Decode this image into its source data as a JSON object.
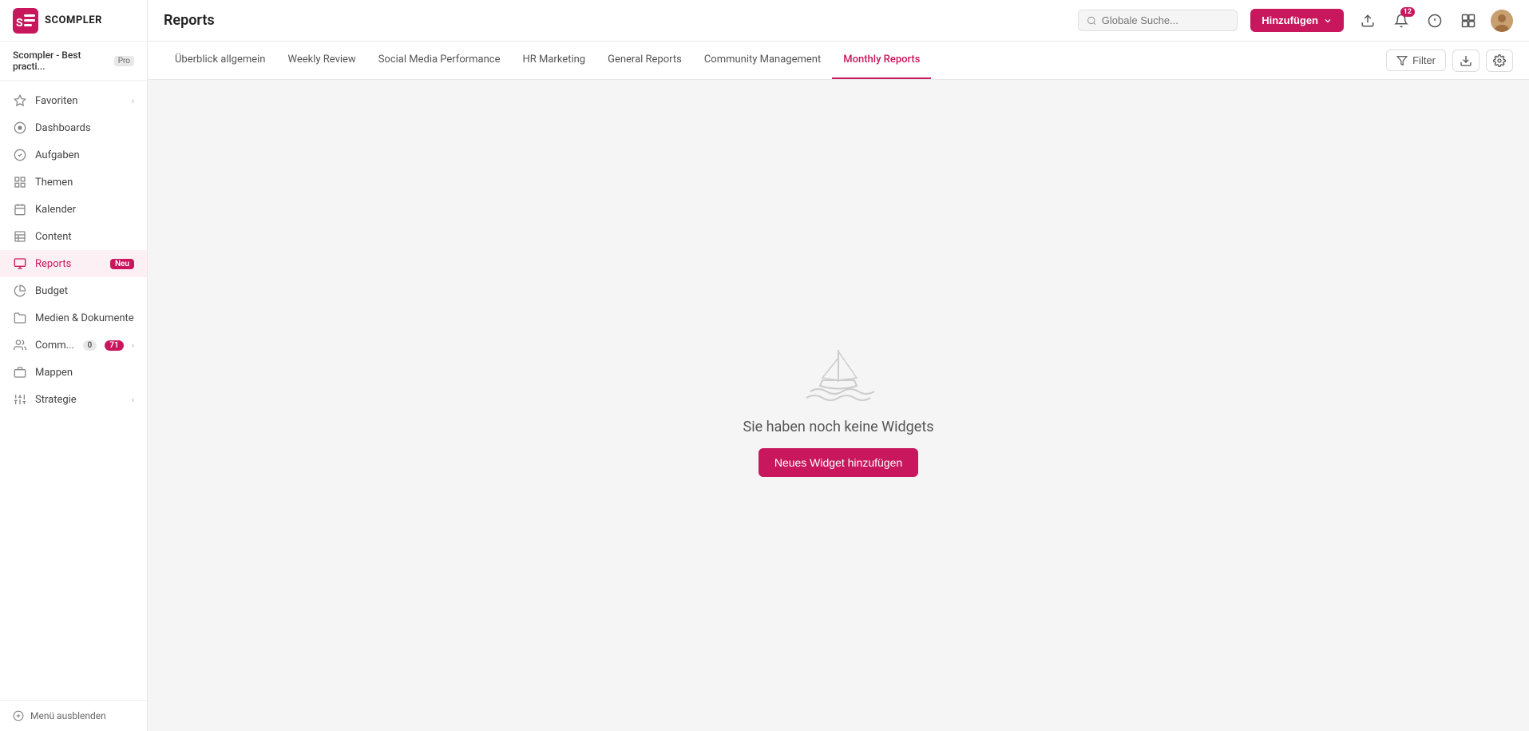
{
  "app": {
    "logo_text": "SCOMPLER"
  },
  "workspace": {
    "name": "Scompler - Best practi...",
    "badge": "Pro"
  },
  "sidebar": {
    "items": [
      {
        "id": "favoriten",
        "label": "Favoriten",
        "icon": "star",
        "has_chevron": true,
        "active": false
      },
      {
        "id": "dashboards",
        "label": "Dashboards",
        "icon": "circle-dot",
        "active": false
      },
      {
        "id": "aufgaben",
        "label": "Aufgaben",
        "icon": "circle-check",
        "active": false
      },
      {
        "id": "themen",
        "label": "Themen",
        "icon": "grid",
        "active": false
      },
      {
        "id": "kalender",
        "label": "Kalender",
        "icon": "calendar",
        "active": false
      },
      {
        "id": "content",
        "label": "Content",
        "icon": "table",
        "active": false
      },
      {
        "id": "reports",
        "label": "Reports",
        "icon": "monitor",
        "active": true,
        "badge": "Neu"
      },
      {
        "id": "budget",
        "label": "Budget",
        "icon": "pie-chart",
        "active": false
      },
      {
        "id": "medien",
        "label": "Medien & Dokumente",
        "icon": "folder",
        "active": false
      },
      {
        "id": "comm",
        "label": "Comm...",
        "icon": "users",
        "active": false,
        "badge_num": "0",
        "badge_pink": "71",
        "has_chevron": true
      },
      {
        "id": "mappen",
        "label": "Mappen",
        "icon": "briefcase",
        "active": false
      },
      {
        "id": "strategie",
        "label": "Strategie",
        "icon": "sliders",
        "active": false,
        "has_chevron": true
      }
    ],
    "footer": {
      "label": "Menü ausblenden"
    }
  },
  "topbar": {
    "title": "Reports",
    "search_placeholder": "Globale Suche...",
    "add_button_label": "Hinzufügen",
    "notification_count": "12"
  },
  "tabs": [
    {
      "id": "uberblick",
      "label": "Überblick allgemein",
      "active": false
    },
    {
      "id": "weekly",
      "label": "Weekly Review",
      "active": false
    },
    {
      "id": "social",
      "label": "Social Media Performance",
      "active": false
    },
    {
      "id": "hr",
      "label": "HR Marketing",
      "active": false
    },
    {
      "id": "general",
      "label": "General Reports",
      "active": false
    },
    {
      "id": "community",
      "label": "Community Management",
      "active": false
    },
    {
      "id": "monthly",
      "label": "Monthly Reports",
      "active": true
    }
  ],
  "tab_actions": {
    "filter_label": "Filter",
    "export_icon": "export",
    "settings_icon": "settings"
  },
  "empty_state": {
    "message": "Sie haben noch keine Widgets",
    "button_label": "Neues Widget hinzufügen"
  }
}
